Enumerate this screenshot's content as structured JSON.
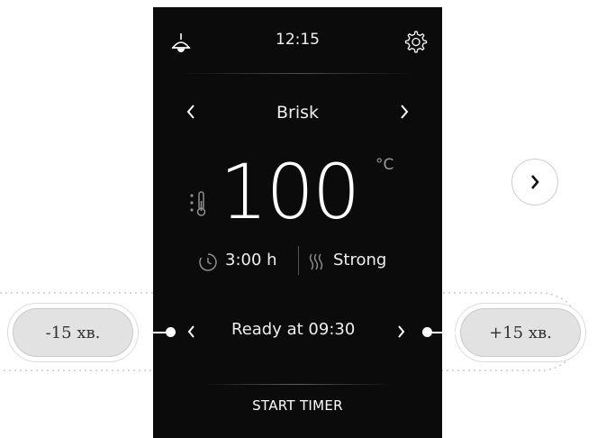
{
  "status_bar": {
    "time": "12:15",
    "left_icon": "hood-lamp-icon",
    "right_icon": "gear-icon"
  },
  "mode": {
    "label": "Brisk",
    "prev_icon": "chevron-left-icon",
    "next_icon": "chevron-right-icon"
  },
  "temperature": {
    "value": "100",
    "unit": "°C",
    "icon": "thermometer-icon"
  },
  "duration": {
    "value": "3:00 h",
    "icon": "clock-icon"
  },
  "steam": {
    "value": "Strong",
    "icon": "steam-icon"
  },
  "ready": {
    "label": "Ready at 09:30"
  },
  "start_label": "START TIMER",
  "callouts": {
    "minus": "-15 хв.",
    "plus": "+15 хв."
  },
  "side_next_icon": "chevron-right-icon",
  "colors": {
    "screen_bg": "#0b0b0b",
    "text": "#ffffff",
    "muted": "#9a9a9a",
    "pill_bg": "#e2e2e2"
  }
}
